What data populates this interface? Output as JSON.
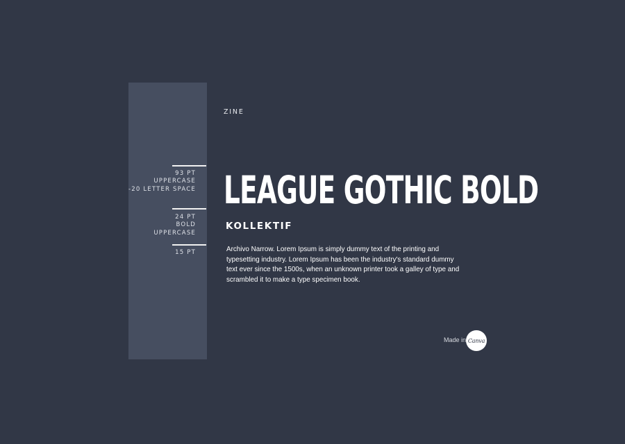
{
  "colors": {
    "background": "#313746",
    "panel": "#464e60",
    "text": "#ffffff"
  },
  "label": "ZINE",
  "headline": "LEAGUE GOTHIC BOLD",
  "subhead": "KOLLEKTIF",
  "body": "Archivo Narrow. Lorem Ipsum is simply dummy text of the printing and typesetting industry. Lorem Ipsum has been the industry's standard dummy text ever since the 1500s, when an unknown printer took a galley of type and scrambled it to make a type specimen book.",
  "specs": {
    "headline": [
      "93 PT",
      "UPPERCASE",
      "-20 LETTER SPACE"
    ],
    "subhead": [
      "24 PT",
      "BOLD",
      "UPPERCASE"
    ],
    "body": [
      "15 PT"
    ]
  },
  "footer": {
    "made_in": "Made in",
    "logo": "Canva",
    "logo_icon": "canva-logo-icon"
  }
}
